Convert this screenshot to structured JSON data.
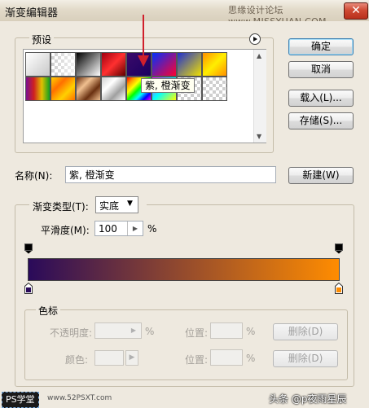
{
  "window": {
    "title": "渐变编辑器",
    "watermark": "思缘设计论坛 www.MISSYUAN.COM",
    "close_glyph": "✕"
  },
  "presets": {
    "label": "预设",
    "tooltip": "紫, 橙渐变"
  },
  "buttons": {
    "ok": "确定",
    "cancel": "取消",
    "load": "载入(L)...",
    "save": "存储(S)...",
    "new": "新建(W)"
  },
  "name": {
    "label": "名称(N):",
    "value": "紫, 橙渐变"
  },
  "gradient_type": {
    "label": "渐变类型(T):",
    "value": "实底"
  },
  "smoothness": {
    "label": "平滑度(M):",
    "value": "100",
    "unit": "%"
  },
  "gradient_bar": {
    "start_color": "#2a0a5a",
    "end_color": "#ff8c00"
  },
  "stops": {
    "label": "色标",
    "opacity_label": "不透明度:",
    "percent": "%",
    "location_label": "位置:",
    "delete": "删除(D)",
    "color_label": "颜色:"
  },
  "footer": {
    "ps_logo": "PS学堂",
    "site": "www.52PSXT.com",
    "credit": "头条 @p夜雨星辰"
  },
  "colors": {
    "arrow": "#d0202c",
    "dialog_bg": "#eee9df"
  }
}
